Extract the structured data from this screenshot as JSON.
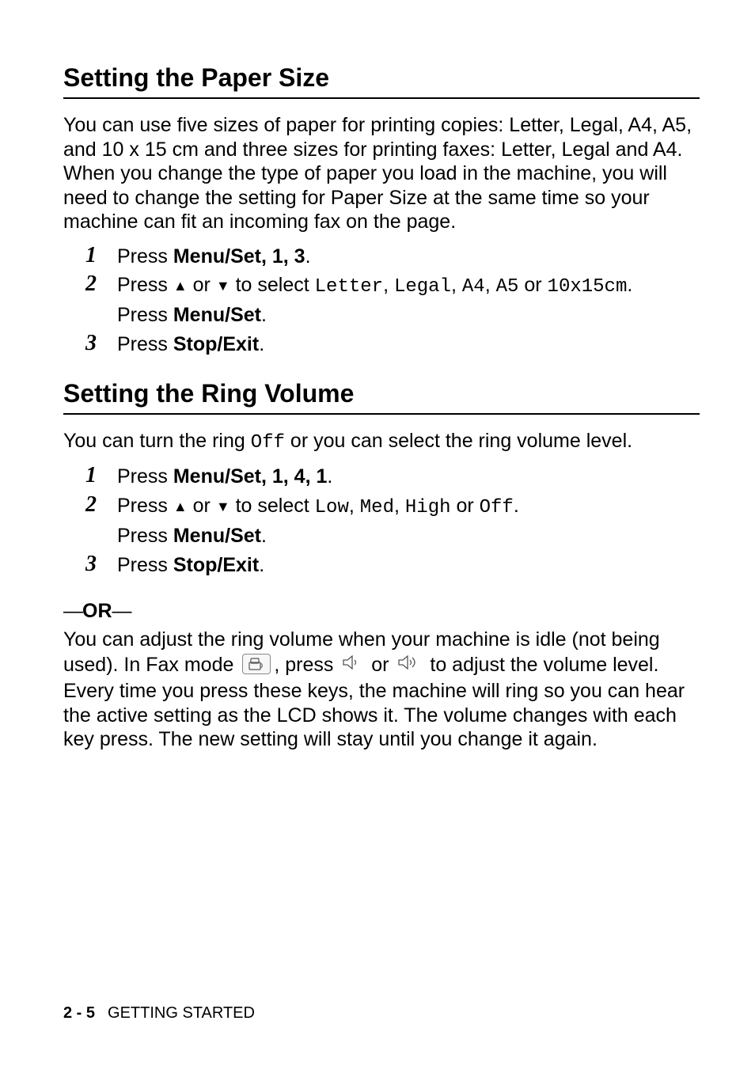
{
  "sections": [
    {
      "title": "Setting the Paper Size",
      "intro": "You can use five sizes of paper for printing copies: Letter, Legal, A4, A5, and 10 x 15 cm and three sizes for printing faxes: Letter, Legal and A4. When you change the type of paper you load in the machine, you will need to change the setting for Paper Size at the same time so your machine can fit an incoming fax on the page.",
      "steps": {
        "s1": {
          "press": "Press ",
          "menuset": "Menu/Set",
          "seq": ", 1, 3",
          "period": "."
        },
        "s2": {
          "press": "Press ",
          "or": " or ",
          "select": " to select ",
          "opts": [
            "Letter",
            "Legal",
            "A4",
            "A5",
            "10x15cm"
          ],
          "sep": [
            ", ",
            ", ",
            ", ",
            " or "
          ],
          "end": ".",
          "press2": "Press ",
          "menuset": "Menu/Set",
          "period2": "."
        },
        "s3": {
          "press": "Press ",
          "stop": "Stop/Exit",
          "period": "."
        }
      }
    },
    {
      "title": "Setting the Ring Volume",
      "intro_pre": "You can turn the ring ",
      "intro_off": "Off",
      "intro_post": " or you can select the ring volume level.",
      "steps": {
        "s1": {
          "press": "Press ",
          "menuset": "Menu/Set",
          "seq": ", 1, 4, 1",
          "period": "."
        },
        "s2": {
          "press": "Press ",
          "or": " or ",
          "select": " to select ",
          "opts": [
            "Low",
            "Med",
            "High",
            "Off"
          ],
          "sep": [
            ", ",
            ", ",
            " or "
          ],
          "end": ".",
          "press2": "Press ",
          "menuset": "Menu/Set",
          "period2": "."
        },
        "s3": {
          "press": "Press ",
          "stop": "Stop/Exit",
          "period": "."
        }
      },
      "or_text": "OR",
      "tail_pre": "You can adjust the ring volume when your machine is idle (not being used). In Fax mode ",
      "tail_mid1": ", press ",
      "tail_mid2": " or ",
      "tail_post": " to adjust the volume level. Every time you press these keys, the machine will ring so you can hear the active setting as the LCD shows it. The volume changes with each key press. The new setting will stay until you change it again."
    }
  ],
  "step_nums": [
    "1",
    "2",
    "3"
  ],
  "footer": {
    "page": "2 - 5",
    "chapter": "GETTING STARTED"
  }
}
